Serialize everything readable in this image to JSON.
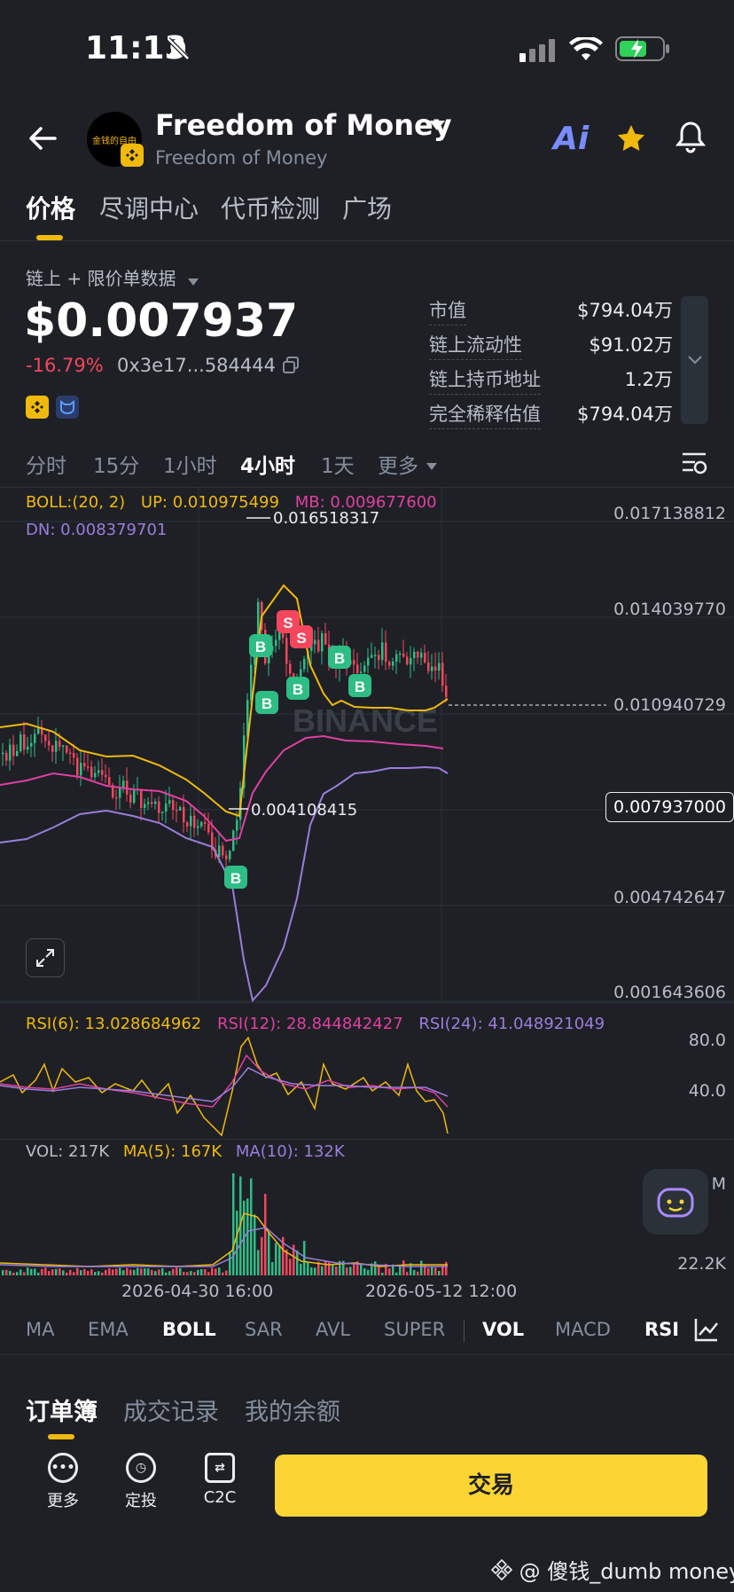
{
  "status": {
    "time": "11:13"
  },
  "header": {
    "token_name": "Freedom of Money",
    "token_subtitle": "Freedom of Money",
    "logo_text": "金钱的自由",
    "ai_label": "Ai"
  },
  "tabs": [
    "价格",
    "尽调中心",
    "代币检测",
    "广场"
  ],
  "price": {
    "data_source": "链上 + 限价单数据",
    "value": "$0.007937",
    "change": "-16.79%",
    "address": "0x3e17...584444"
  },
  "stats": [
    {
      "label": "市值",
      "value": "$794.04万"
    },
    {
      "label": "链上流动性",
      "value": "$91.02万"
    },
    {
      "label": "链上持币地址",
      "value": "1.2万"
    },
    {
      "label": "完全稀释估值",
      "value": "$794.04万"
    }
  ],
  "intervals": [
    "分时",
    "15分",
    "1小时",
    "4小时",
    "1天",
    "更多"
  ],
  "active_interval": "4小时",
  "boll": {
    "label": "BOLL:(20, 2)",
    "up": "UP: 0.010975499",
    "mb": "MB: 0.009677600",
    "dn": "DN: 0.008379701"
  },
  "main_chart": {
    "y_labels": [
      "0.017138812",
      "0.014039770",
      "0.010940729",
      "0.004742647",
      "0.001643606"
    ],
    "high_label": "0.016518317",
    "low_label": "0.004108415",
    "current_price_label": "0.007937000",
    "watermark": "BINANCE"
  },
  "rsi": {
    "rsi6": "RSI(6): 13.028684962",
    "rsi12": "RSI(12): 28.844842427",
    "rsi24": "RSI(24): 41.048921049",
    "y_labels": [
      "80.0",
      "40.0"
    ]
  },
  "vol": {
    "vol": "VOL: 217K",
    "ma5": "MA(5): 167K",
    "ma10": "MA(10): 132K",
    "y_top": "M",
    "y_bottom": "22.2K"
  },
  "x_labels": [
    "2026-04-30 16:00",
    "2026-05-12 12:00"
  ],
  "indicators": [
    "MA",
    "EMA",
    "BOLL",
    "SAR",
    "AVL",
    "SUPER",
    "VOL",
    "MACD",
    "RSI"
  ],
  "bottom_tabs": [
    "订单簿",
    "成交记录",
    "我的余额"
  ],
  "actions": [
    "更多",
    "定投",
    "C2C"
  ],
  "trade_button": "交易",
  "footer_watermark": "@ 傻钱_dumb money",
  "colors": {
    "up": "#2ebd85",
    "down": "#f6465d",
    "yellow": "#fcd535",
    "boll_up": "#f0b90b",
    "boll_mb": "#e040a0",
    "boll_dn": "#9b7ddc"
  }
}
